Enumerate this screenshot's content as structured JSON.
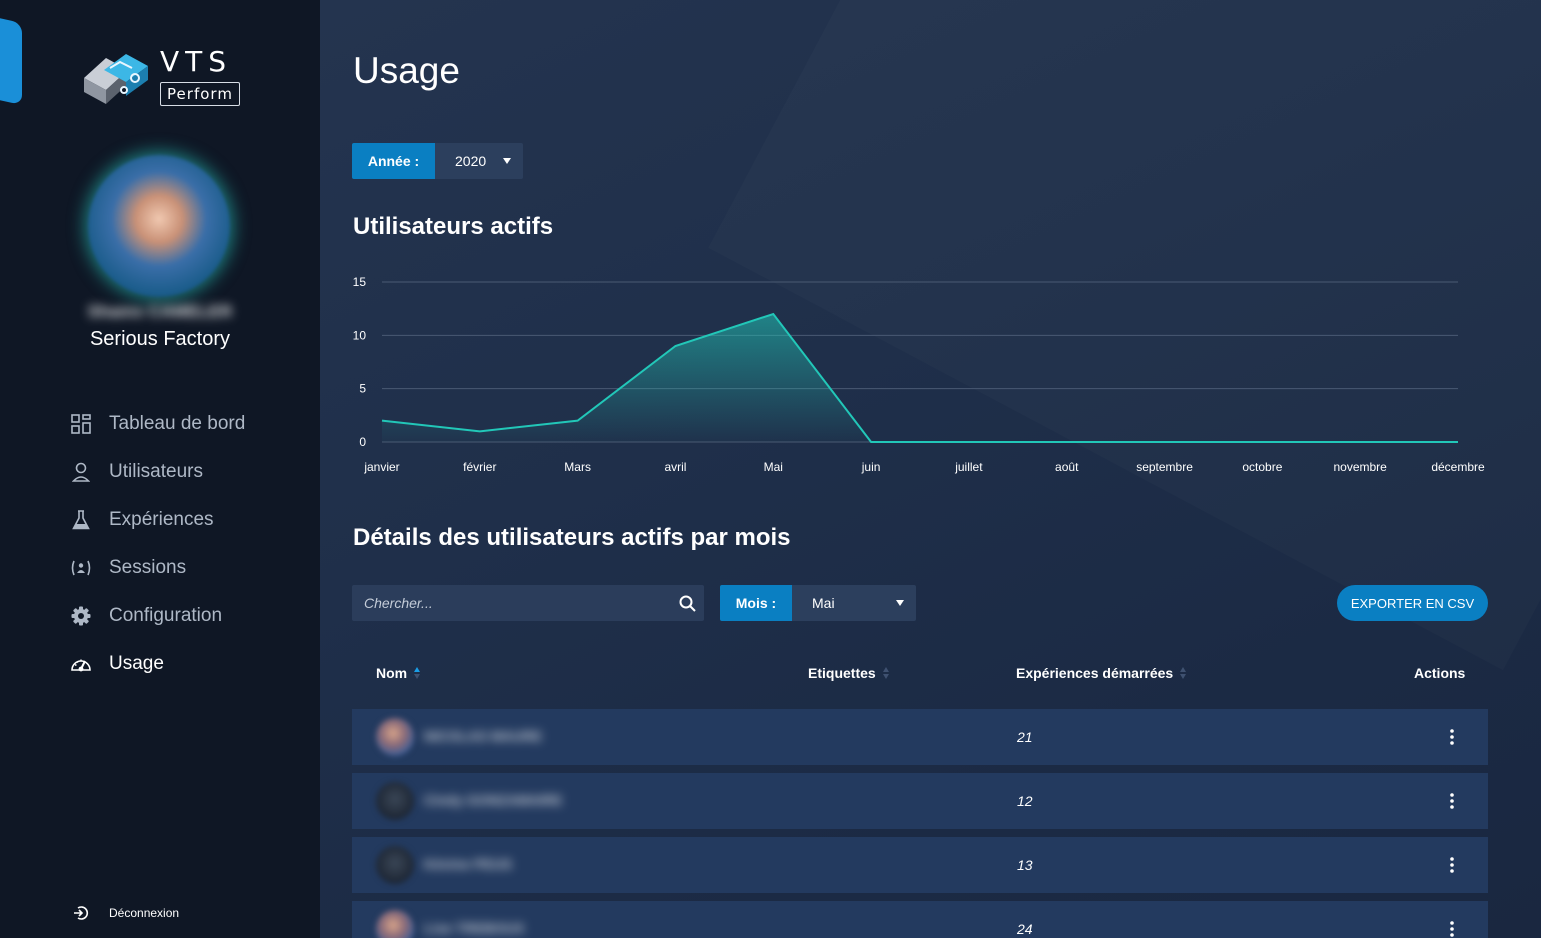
{
  "brand": {
    "logo_title": "VTS",
    "logo_subtitle": "Perform",
    "accent_color": "#0a7fc2",
    "chart_color": "#22c7b8"
  },
  "user": {
    "name": "Shams CAMELER",
    "company": "Serious Factory"
  },
  "nav": {
    "items": [
      {
        "label": "Tableau de bord",
        "icon": "dashboard-icon"
      },
      {
        "label": "Utilisateurs",
        "icon": "user-icon"
      },
      {
        "label": "Expériences",
        "icon": "flask-icon"
      },
      {
        "label": "Sessions",
        "icon": "sessions-icon"
      },
      {
        "label": "Configuration",
        "icon": "gear-icon"
      },
      {
        "label": "Usage",
        "icon": "gauge-icon",
        "active": true
      }
    ],
    "logout_label": "Déconnexion"
  },
  "page": {
    "title": "Usage",
    "year_filter": {
      "label": "Année :",
      "value": "2020"
    },
    "chart_title": "Utilisateurs actifs",
    "details_title": "Détails des utilisateurs actifs par mois",
    "search": {
      "placeholder": "Chercher..."
    },
    "month_filter": {
      "label": "Mois :",
      "value": "Mai"
    },
    "export_label": "EXPORTER EN CSV"
  },
  "table": {
    "columns": [
      {
        "label": "Nom",
        "sort": "asc"
      },
      {
        "label": "Etiquettes",
        "sort": "none"
      },
      {
        "label": "Expériences démarrées",
        "sort": "none"
      },
      {
        "label": "Actions"
      }
    ],
    "rows": [
      {
        "name": "NICOLAS MAURE",
        "count": "21"
      },
      {
        "name": "Cindy GONZAMAIRE",
        "count": "12"
      },
      {
        "name": "Kévine PEUS",
        "count": "13"
      },
      {
        "name": "Lise TREBOUX",
        "count": "24"
      }
    ]
  },
  "chart_data": {
    "type": "area",
    "title": "Utilisateurs actifs",
    "categories": [
      "janvier",
      "février",
      "Mars",
      "avril",
      "Mai",
      "juin",
      "juillet",
      "août",
      "septembre",
      "octobre",
      "novembre",
      "décembre"
    ],
    "values": [
      2,
      1,
      2,
      9,
      12,
      0,
      0,
      0,
      0,
      0,
      0,
      0
    ],
    "ylim": [
      0,
      15
    ],
    "yticks": [
      0,
      5,
      10,
      15
    ],
    "grid": true,
    "xlabel": "",
    "ylabel": ""
  }
}
